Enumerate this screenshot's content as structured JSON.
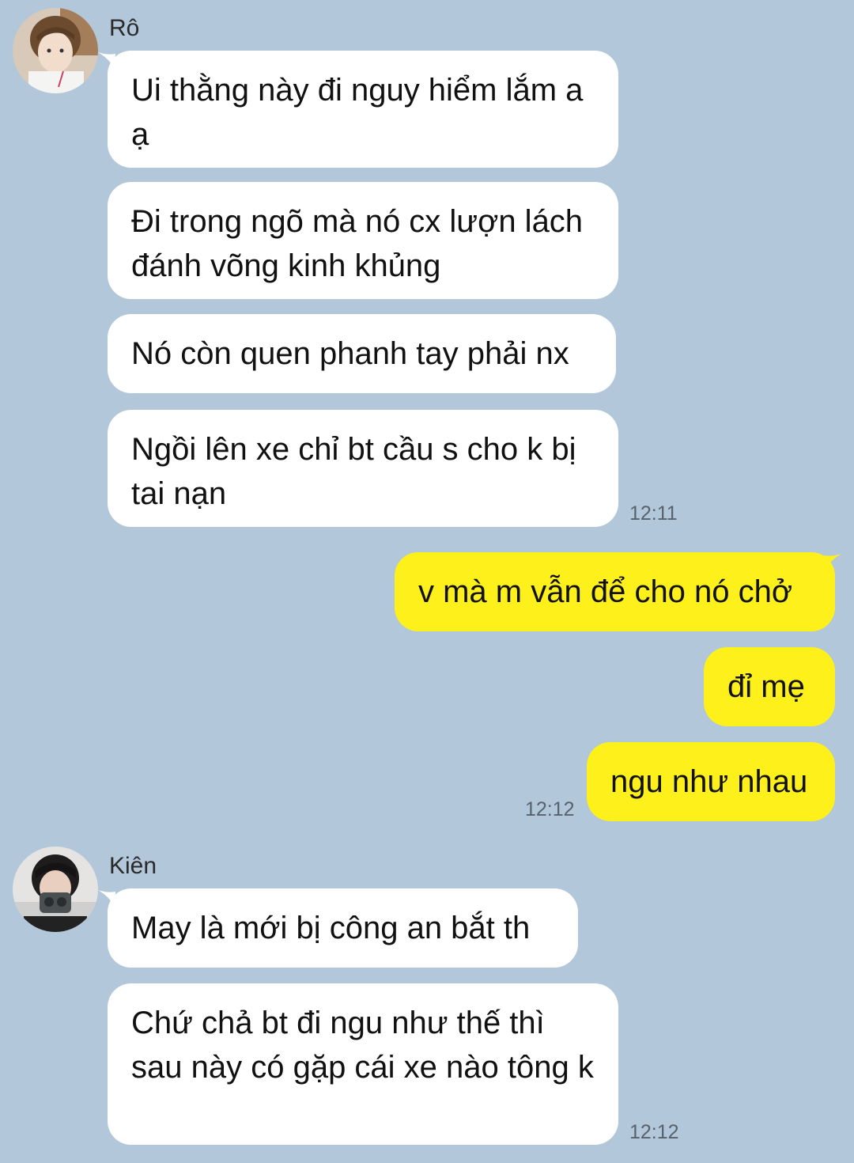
{
  "conversation": {
    "groups": [
      {
        "sender": "Rô",
        "messages": [
          "Ui thằng này đi nguy hiểm lắm a ạ",
          "Đi trong ngõ mà nó cx lượn lách đánh võng kinh khủng",
          "Nó còn quen phanh tay phải nx",
          "Ngồi lên xe chỉ bt cầu s cho k bị tai nạn"
        ],
        "time": "12:11"
      },
      {
        "sender": "me",
        "messages": [
          "v mà m vẫn để cho nó chở",
          "đỉ mẹ",
          "ngu như nhau"
        ],
        "time": "12:12"
      },
      {
        "sender": "Kiên",
        "messages": [
          "May là mới bị công an bắt th",
          "Chứ chả bt đi ngu như thế thì sau này có gặp cái xe nào tông k"
        ],
        "time": "12:12"
      }
    ]
  },
  "colors": {
    "background": "#b2c7da",
    "incoming_bubble": "#ffffff",
    "outgoing_bubble": "#fef01b"
  }
}
